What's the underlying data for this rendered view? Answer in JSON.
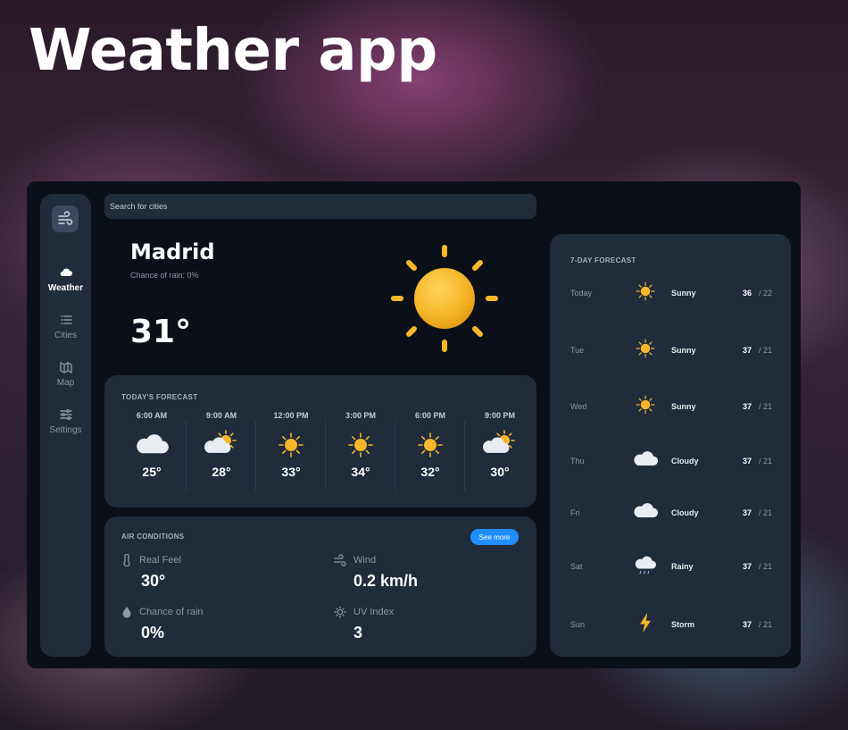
{
  "hero": {
    "title": "Weather app"
  },
  "sidebar": {
    "items": [
      {
        "label": "Weather",
        "icon": "weather-icon",
        "active": true
      },
      {
        "label": "Cities",
        "icon": "list-icon",
        "active": false
      },
      {
        "label": "Map",
        "icon": "map-icon",
        "active": false
      },
      {
        "label": "Settings",
        "icon": "settings-icon",
        "active": false
      }
    ]
  },
  "search": {
    "placeholder": "Search for cities"
  },
  "current": {
    "city": "Madrid",
    "rain_chance": "Chance of rain: 0%",
    "temp": "31°",
    "icon": "sun-icon"
  },
  "today": {
    "title": "Today's forecast",
    "hours": [
      {
        "time": "6:00 AM",
        "icon": "cloud",
        "temp": "25°"
      },
      {
        "time": "9:00 AM",
        "icon": "partly-cloudy",
        "temp": "28°"
      },
      {
        "time": "12:00 PM",
        "icon": "sun",
        "temp": "33°"
      },
      {
        "time": "3:00 PM",
        "icon": "sun",
        "temp": "34°"
      },
      {
        "time": "6:00 PM",
        "icon": "sun",
        "temp": "32°"
      },
      {
        "time": "9:00 PM",
        "icon": "partly-cloudy",
        "temp": "30°"
      }
    ]
  },
  "air": {
    "title": "Air conditions",
    "see_more": "See more",
    "items": [
      {
        "label": "Real Feel",
        "value": "30°",
        "icon": "thermometer-icon"
      },
      {
        "label": "Wind",
        "value": "0.2 km/h",
        "icon": "wind-icon"
      },
      {
        "label": "Chance of rain",
        "value": "0%",
        "icon": "droplet-icon"
      },
      {
        "label": "UV Index",
        "value": "3",
        "icon": "sun-outline-icon"
      }
    ]
  },
  "week": {
    "title": "7-Day Forecast",
    "days": [
      {
        "day": "Today",
        "icon": "sun",
        "cond": "Sunny",
        "hi": "36",
        "lo": "/ 22"
      },
      {
        "day": "Tue",
        "icon": "sun",
        "cond": "Sunny",
        "hi": "37",
        "lo": "/ 21"
      },
      {
        "day": "Wed",
        "icon": "sun",
        "cond": "Sunny",
        "hi": "37",
        "lo": "/ 21"
      },
      {
        "day": "Thu",
        "icon": "cloud",
        "cond": "Cloudy",
        "hi": "37",
        "lo": "/ 21"
      },
      {
        "day": "Fri",
        "icon": "cloud",
        "cond": "Cloudy",
        "hi": "37",
        "lo": "/ 21"
      },
      {
        "day": "Sat",
        "icon": "rain-cloud",
        "cond": "Rainy",
        "hi": "37",
        "lo": "/ 21"
      },
      {
        "day": "Sun",
        "icon": "storm",
        "cond": "Storm",
        "hi": "37",
        "lo": "/ 21"
      }
    ]
  },
  "colors": {
    "accent": "#1f8fff",
    "panel": "#202b3b",
    "background": "#0b1018",
    "sun": "#f6b72b"
  }
}
